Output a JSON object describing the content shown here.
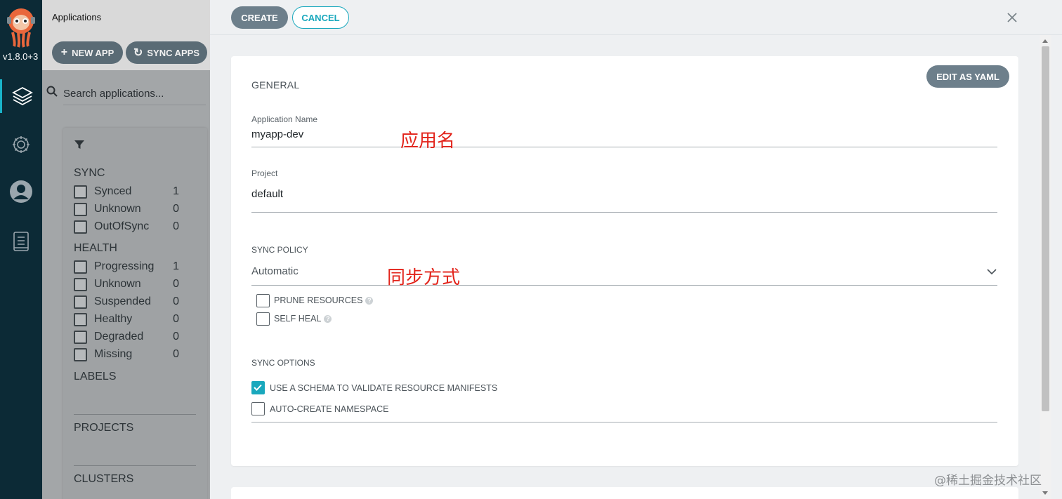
{
  "rail": {
    "version": "v1.8.0+3",
    "items": [
      {
        "icon": "layers-icon"
      },
      {
        "icon": "gear-icon"
      },
      {
        "icon": "user-icon"
      },
      {
        "icon": "docs-icon"
      }
    ]
  },
  "apps": {
    "title": "Applications",
    "new_app_label": "NEW APP",
    "sync_apps_label": "SYNC APPS",
    "search_placeholder": "Search applications...",
    "filters": {
      "sync_title": "SYNC",
      "sync": [
        {
          "label": "Synced",
          "count": "1"
        },
        {
          "label": "Unknown",
          "count": "0"
        },
        {
          "label": "OutOfSync",
          "count": "0"
        }
      ],
      "health_title": "HEALTH",
      "health": [
        {
          "label": "Progressing",
          "count": "1"
        },
        {
          "label": "Unknown",
          "count": "0"
        },
        {
          "label": "Suspended",
          "count": "0"
        },
        {
          "label": "Healthy",
          "count": "0"
        },
        {
          "label": "Degraded",
          "count": "0"
        },
        {
          "label": "Missing",
          "count": "0"
        }
      ],
      "labels_title": "LABELS",
      "projects_title": "PROJECTS",
      "clusters_title": "CLUSTERS"
    }
  },
  "panel": {
    "create_label": "CREATE",
    "cancel_label": "CANCEL",
    "edit_yaml_label": "EDIT AS YAML",
    "general_title": "GENERAL",
    "app_name_label": "Application Name",
    "app_name_value": "myapp-dev",
    "project_label": "Project",
    "project_value": "default",
    "sync_policy_title": "SYNC POLICY",
    "sync_policy_value": "Automatic",
    "prune_label": "PRUNE RESOURCES",
    "self_heal_label": "SELF HEAL",
    "sync_options_title": "SYNC OPTIONS",
    "validate_label": "USE A SCHEMA TO VALIDATE RESOURCE MANIFESTS",
    "validate_checked": true,
    "auto_ns_label": "AUTO-CREATE NAMESPACE",
    "auto_ns_checked": false,
    "prune_checked": false,
    "self_heal_checked": false
  },
  "annotations": {
    "app_name_note": "应用名",
    "sync_policy_note": "同步方式"
  },
  "watermark": "@稀土掘金技术社区",
  "colors": {
    "accent": "#19a8bd",
    "button": "#6d7f8b",
    "annotation": "#e2231a",
    "rail": "#0c2a36"
  }
}
